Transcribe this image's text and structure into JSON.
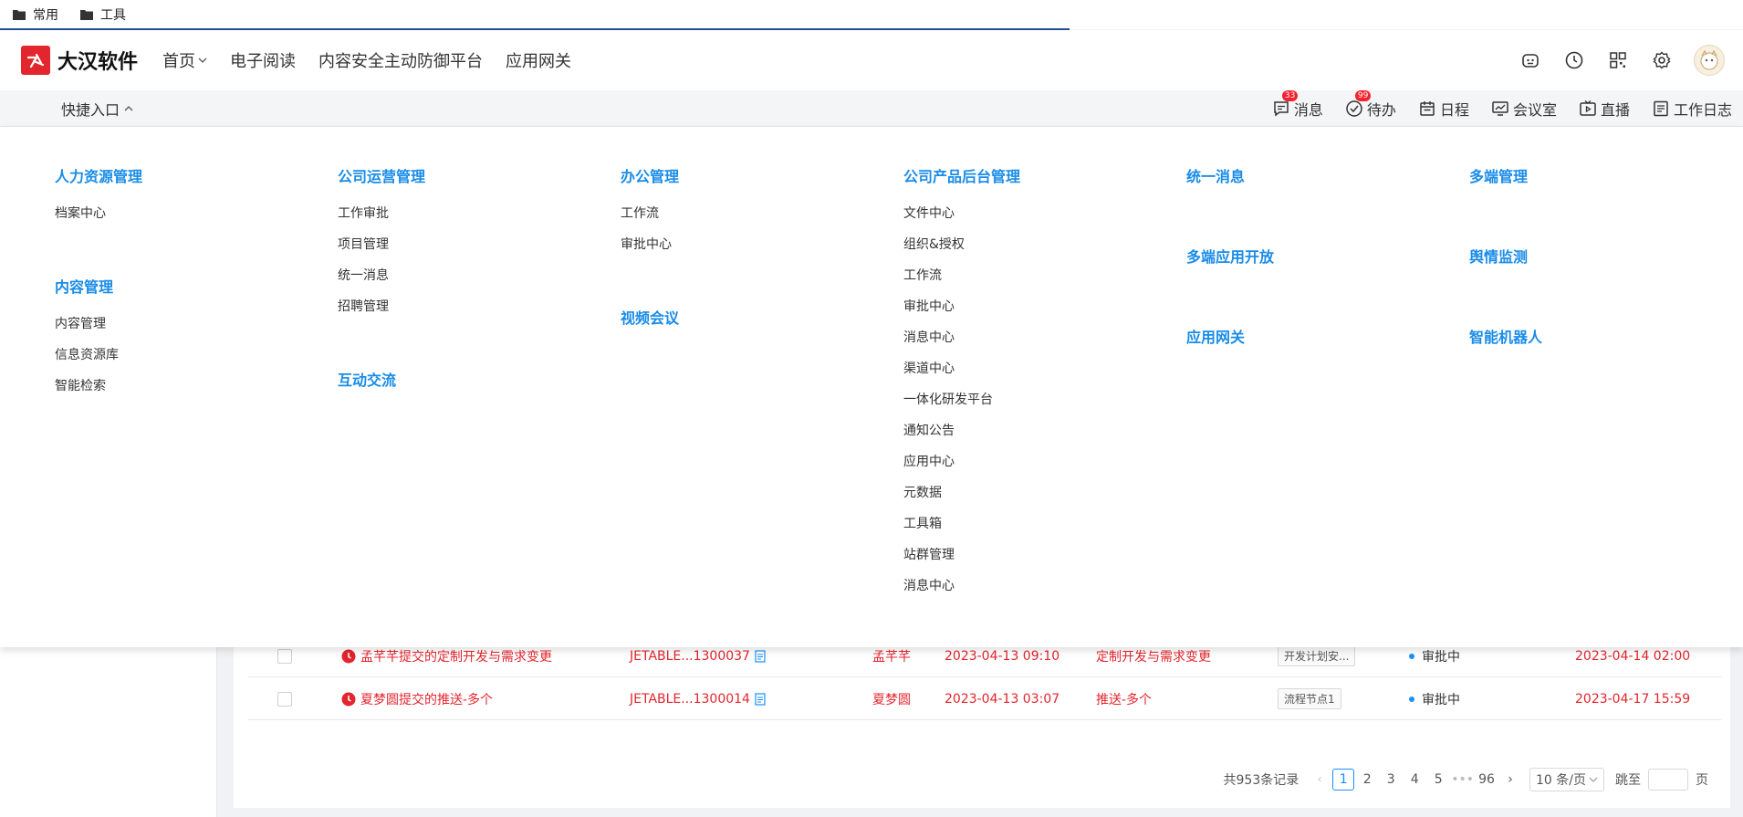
{
  "bookmarks": [
    {
      "label": "常用"
    },
    {
      "label": "工具"
    }
  ],
  "header": {
    "brand": "大汉软件",
    "nav": [
      {
        "label": "首页"
      },
      {
        "label": "电子阅读"
      },
      {
        "label": "内容安全主动防御平台"
      },
      {
        "label": "应用网关"
      }
    ]
  },
  "quickbar": {
    "title": "快捷入口",
    "shortcuts": [
      {
        "label": "消息",
        "badge": "33"
      },
      {
        "label": "待办",
        "badge": "99"
      },
      {
        "label": "日程"
      },
      {
        "label": "会议室"
      },
      {
        "label": "直播"
      },
      {
        "label": "工作日志"
      }
    ]
  },
  "menu": {
    "col1": {
      "g1": {
        "title": "人力资源管理",
        "items": [
          "档案中心"
        ]
      },
      "g2": {
        "title": "内容管理",
        "items": [
          "内容管理",
          "信息资源库",
          "智能检索"
        ]
      }
    },
    "col2": {
      "g1": {
        "title": "公司运营管理",
        "items": [
          "工作审批",
          "项目管理",
          "统一消息",
          "招聘管理"
        ]
      },
      "g2": {
        "title": "互动交流"
      }
    },
    "col3": {
      "g1": {
        "title": "办公管理",
        "items": [
          "工作流",
          "审批中心"
        ]
      },
      "g2": {
        "title": "视频会议"
      }
    },
    "col4": {
      "g1": {
        "title": "公司产品后台管理",
        "items": [
          "文件中心",
          "组织&授权",
          "工作流",
          "审批中心",
          "消息中心",
          "渠道中心",
          "一体化研发平台",
          "通知公告",
          "应用中心",
          "元数据",
          "工具箱",
          "站群管理",
          "消息中心"
        ]
      }
    },
    "col5": {
      "titles": [
        "统一消息",
        "多端应用开放",
        "应用网关"
      ]
    },
    "col6": {
      "titles": [
        "多端管理",
        "舆情监测",
        "智能机器人"
      ]
    }
  },
  "table": {
    "rows": [
      {
        "title": "孟芊芊提交的定制开发与需求变更",
        "code": "JETABLE...1300037",
        "user": "孟芊芊",
        "time": "2023-04-13 09:10",
        "type": "定制开发与需求变更",
        "node": "开发计划安...",
        "status": "审批中",
        "deadline": "2023-04-14 02:00"
      },
      {
        "title": "夏梦圆提交的推送-多个",
        "code": "JETABLE...1300014",
        "user": "夏梦圆",
        "time": "2023-04-13 03:07",
        "type": "推送-多个",
        "node": "流程节点1",
        "status": "审批中",
        "deadline": "2023-04-17 15:59"
      }
    ]
  },
  "pagination": {
    "total": "共953条记录",
    "pages": [
      "1",
      "2",
      "3",
      "4",
      "5"
    ],
    "ellipsis": "•••",
    "last": "96",
    "page_size": "10 条/页",
    "jump_label": "跳至",
    "page_suffix": "页"
  }
}
